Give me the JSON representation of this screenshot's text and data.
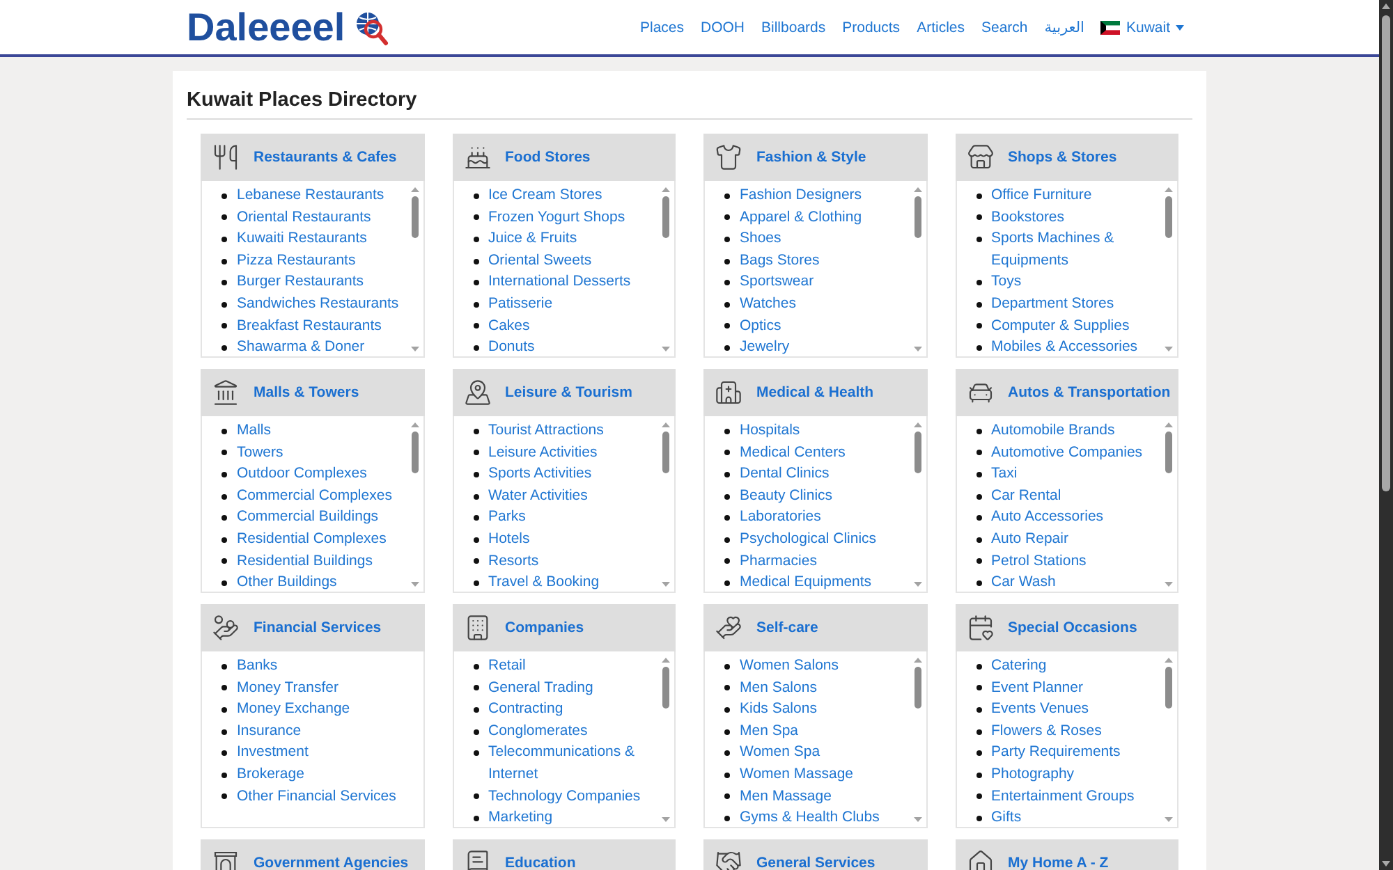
{
  "header": {
    "logo": "Daleeeel",
    "nav": [
      "Places",
      "DOOH",
      "Billboards",
      "Products",
      "Articles",
      "Search",
      "العربية"
    ],
    "country": {
      "label": "Kuwait"
    }
  },
  "directory": {
    "title": "Kuwait Places Directory",
    "categories": [
      {
        "title": "Restaurants & Cafes",
        "scrollable": true,
        "items": [
          "Lebanese Restaurants",
          "Oriental Restaurants",
          "Kuwaiti Restaurants",
          "Pizza Restaurants",
          "Burger Restaurants",
          "Sandwiches Restaurants",
          "Breakfast Restaurants",
          "Shawarma & Doner"
        ]
      },
      {
        "title": "Food Stores",
        "scrollable": true,
        "items": [
          "Ice Cream Stores",
          "Frozen Yogurt Shops",
          "Juice & Fruits",
          "Oriental Sweets",
          "International Desserts",
          "Patisserie",
          "Cakes",
          "Donuts"
        ]
      },
      {
        "title": "Fashion & Style",
        "scrollable": true,
        "items": [
          "Fashion Designers",
          "Apparel & Clothing",
          "Shoes",
          "Bags Stores",
          "Sportswear",
          "Watches",
          "Optics",
          "Jewelry"
        ]
      },
      {
        "title": "Shops & Stores",
        "scrollable": true,
        "items": [
          "Office Furniture",
          "Bookstores",
          "Sports Machines & Equipments",
          "Toys",
          "Department Stores",
          "Computer & Supplies",
          "Mobiles & Accessories"
        ]
      },
      {
        "title": "Malls & Towers",
        "scrollable": true,
        "items": [
          "Malls",
          "Towers",
          "Outdoor Complexes",
          "Commercial Complexes",
          "Commercial Buildings",
          "Residential Complexes",
          "Residential Buildings",
          "Other Buildings"
        ]
      },
      {
        "title": "Leisure & Tourism",
        "scrollable": true,
        "items": [
          "Tourist Attractions",
          "Leisure Activities",
          "Sports Activities",
          "Water Activities",
          "Parks",
          "Hotels",
          "Resorts",
          "Travel & Booking"
        ]
      },
      {
        "title": "Medical & Health",
        "scrollable": true,
        "items": [
          "Hospitals",
          "Medical Centers",
          "Dental Clinics",
          "Beauty Clinics",
          "Laboratories",
          "Psychological Clinics",
          "Pharmacies",
          "Medical Equipments"
        ]
      },
      {
        "title": "Autos & Transportation",
        "scrollable": true,
        "items": [
          "Automobile Brands",
          "Automotive Companies",
          "Taxi",
          "Car Rental",
          "Auto Accessories",
          "Auto Repair",
          "Petrol Stations",
          "Car Wash"
        ]
      },
      {
        "title": "Financial Services",
        "scrollable": false,
        "items": [
          "Banks",
          "Money Transfer",
          "Money Exchange",
          "Insurance",
          "Investment",
          "Brokerage",
          "Other Financial Services"
        ]
      },
      {
        "title": "Companies",
        "scrollable": true,
        "items": [
          "Retail",
          "General Trading",
          "Contracting",
          "Conglomerates",
          "Telecommunications & Internet",
          "Technology Companies",
          "Marketing"
        ]
      },
      {
        "title": "Self-care",
        "scrollable": true,
        "items": [
          "Women Salons",
          "Men Salons",
          "Kids Salons",
          "Men Spa",
          "Women Spa",
          "Women Massage",
          "Men Massage",
          "Gyms & Health Clubs"
        ]
      },
      {
        "title": "Special Occasions",
        "scrollable": true,
        "items": [
          "Catering",
          "Event Planner",
          "Events Venues",
          "Flowers & Roses",
          "Party Requirements",
          "Photography",
          "Entertainment Groups",
          "Gifts"
        ]
      },
      {
        "title": "Government Agencies"
      },
      {
        "title": "Education"
      },
      {
        "title": "General Services"
      },
      {
        "title": "My Home A - Z"
      }
    ]
  }
}
